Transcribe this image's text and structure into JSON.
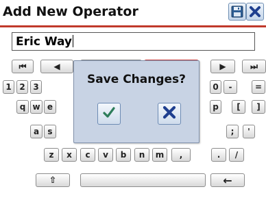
{
  "window": {
    "title": "Add New Operator"
  },
  "toolbar": {
    "save_icon": "floppy-save-icon",
    "close_icon": "close-x-icon"
  },
  "input": {
    "value": "Eric Way"
  },
  "keyboard": {
    "row0": [
      "⏮",
      "◀",
      "",
      "",
      "▶",
      "⏭"
    ],
    "row1": [
      "1",
      "2",
      "3",
      "0",
      "-",
      "="
    ],
    "row2": [
      "q",
      "w",
      "e",
      "p",
      "[",
      "]"
    ],
    "row3": [
      "a",
      "s",
      ";",
      "'"
    ],
    "row4": [
      "z",
      "x",
      "c",
      "v",
      "b",
      "n",
      "m",
      ",",
      ".",
      "/"
    ],
    "row5": [
      "⇧",
      "",
      "←"
    ]
  },
  "dialog": {
    "title": "Save Changes?",
    "confirm_icon": "checkmark-icon",
    "cancel_icon": "x-icon",
    "confirm_color": "#2e7d5a",
    "cancel_color": "#1f3f8f"
  }
}
